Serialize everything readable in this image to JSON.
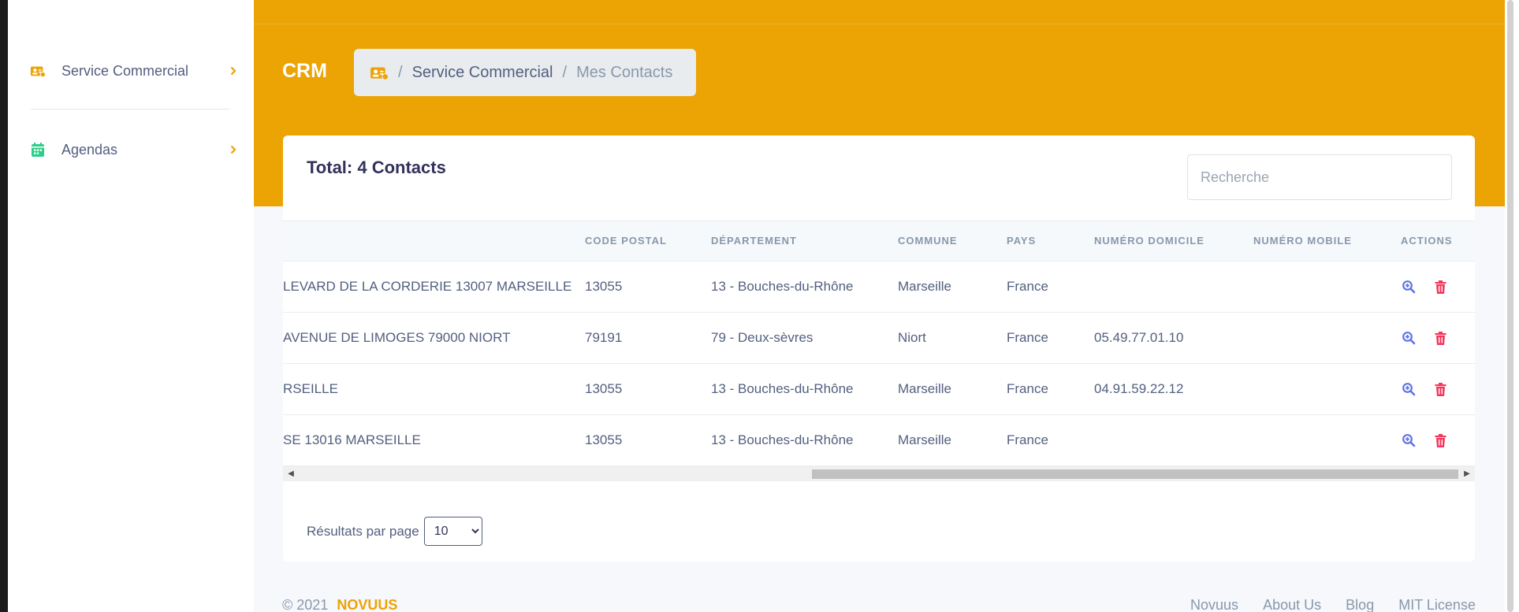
{
  "colors": {
    "accent": "#eca304",
    "search_icon": "#5e72e4",
    "delete_icon": "#f5365c",
    "agenda_icon": "#2dce89"
  },
  "sidebar": {
    "items": [
      {
        "label": "Service Commercial",
        "icon": "contact-card-icon"
      },
      {
        "label": "Agendas",
        "icon": "calendar-icon"
      }
    ]
  },
  "header": {
    "title": "CRM",
    "breadcrumb": {
      "sep1": "/",
      "link": "Service Commercial",
      "sep2": "/",
      "current": "Mes Contacts"
    }
  },
  "card": {
    "total": "Total: 4 Contacts",
    "search_placeholder": "Recherche",
    "columns": [
      "CODE POSTAL",
      "DÉPARTEMENT",
      "COMMUNE",
      "PAYS",
      "NUMÉRO DOMICILE",
      "NUMÉRO MOBILE",
      "ACTIONS"
    ],
    "rows": [
      {
        "address": "LEVARD DE LA CORDERIE 13007 MARSEILLE",
        "postal": "13055",
        "departement": "13 - Bouches-du-Rhône",
        "commune": "Marseille",
        "pays": "France",
        "domicile": "",
        "mobile": ""
      },
      {
        "address": "AVENUE DE LIMOGES 79000 NIORT",
        "postal": "79191",
        "departement": "79 - Deux-sèvres",
        "commune": "Niort",
        "pays": "France",
        "domicile": "05.49.77.01.10",
        "mobile": ""
      },
      {
        "address": "RSEILLE",
        "postal": "13055",
        "departement": "13 - Bouches-du-Rhône",
        "commune": "Marseille",
        "pays": "France",
        "domicile": "04.91.59.22.12",
        "mobile": ""
      },
      {
        "address": "SE 13016 MARSEILLE",
        "postal": "13055",
        "departement": "13 - Bouches-du-Rhône",
        "commune": "Marseille",
        "pays": "France",
        "domicile": "",
        "mobile": ""
      }
    ],
    "per_page_label": "Résultats par page",
    "per_page_value": "10"
  },
  "footer": {
    "copyright": "© 2021",
    "brand": "NOVUUS",
    "links": [
      "Novuus",
      "About Us",
      "Blog",
      "MIT License"
    ]
  }
}
